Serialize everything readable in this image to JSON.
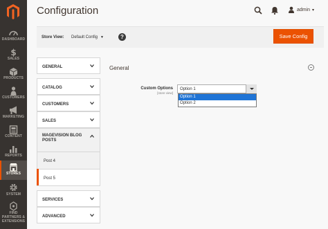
{
  "app": {
    "title": "Configuration",
    "username": "admin"
  },
  "nav": {
    "items": [
      {
        "label": "DASHBOARD",
        "icon": "dashboard-icon"
      },
      {
        "label": "SALES",
        "icon": "dollar-icon"
      },
      {
        "label": "PRODUCTS",
        "icon": "cube-icon"
      },
      {
        "label": "CUSTOMERS",
        "icon": "person-icon"
      },
      {
        "label": "MARKETING",
        "icon": "megaphone-icon"
      },
      {
        "label": "CONTENT",
        "icon": "content-icon"
      },
      {
        "label": "REPORTS",
        "icon": "bar-chart-icon"
      },
      {
        "label": "STORES",
        "icon": "store-icon"
      },
      {
        "label": "SYSTEM",
        "icon": "gear-icon"
      },
      {
        "label": "FIND PARTNERS & EXTENSIONS",
        "icon": "partners-icon"
      }
    ],
    "active": "STORES"
  },
  "store_bar": {
    "label": "Store View:",
    "value": "Default Config",
    "save_label": "Save Config"
  },
  "tabs": {
    "general": "GENERAL",
    "catalog": "CATALOG",
    "customers": "CUSTOMERS",
    "sales": "SALES",
    "blog": "MAGEVISION BLOG POSTS",
    "post4": "Post 4",
    "post5": "Post 5",
    "services": "SERVICES",
    "advanced": "ADVANCED"
  },
  "section": {
    "title": "General",
    "field_label": "Custom Options",
    "field_scope": "[store view]",
    "select_value": "Option 1",
    "options": [
      "Option 1",
      "Option 2"
    ],
    "selected_option": "Option 1"
  },
  "colors": {
    "accent": "#eb5202",
    "nav_bg": "#373330",
    "highlight": "#1f74d6"
  }
}
